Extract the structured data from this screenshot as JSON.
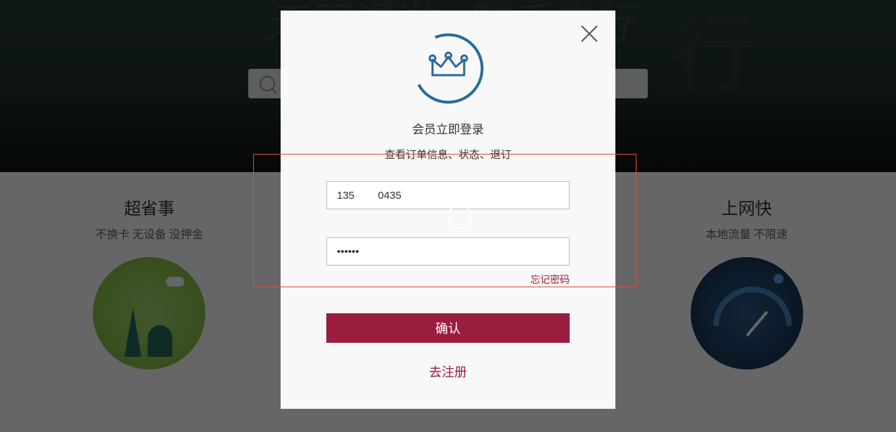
{
  "hero": {
    "script_text": "无限漫游 · 随手走行",
    "figure_text": "行"
  },
  "features": {
    "left": {
      "title": "超省事",
      "sub": "不换卡 无设备 没押金"
    },
    "right": {
      "title": "上网快",
      "sub": "本地流量 不限速"
    }
  },
  "modal": {
    "title": "会员立即登录",
    "subtitle": "查看订单信息、状态、退订",
    "phone_value": "135        0435",
    "password_value": "••••••",
    "forgot_label": "忘记密码",
    "confirm_label": "确认",
    "register_label": "去注册"
  },
  "colors": {
    "accent": "#9a1d3f",
    "highlight_border": "#e74c3c",
    "logo_stroke": "#2a6a9a"
  }
}
